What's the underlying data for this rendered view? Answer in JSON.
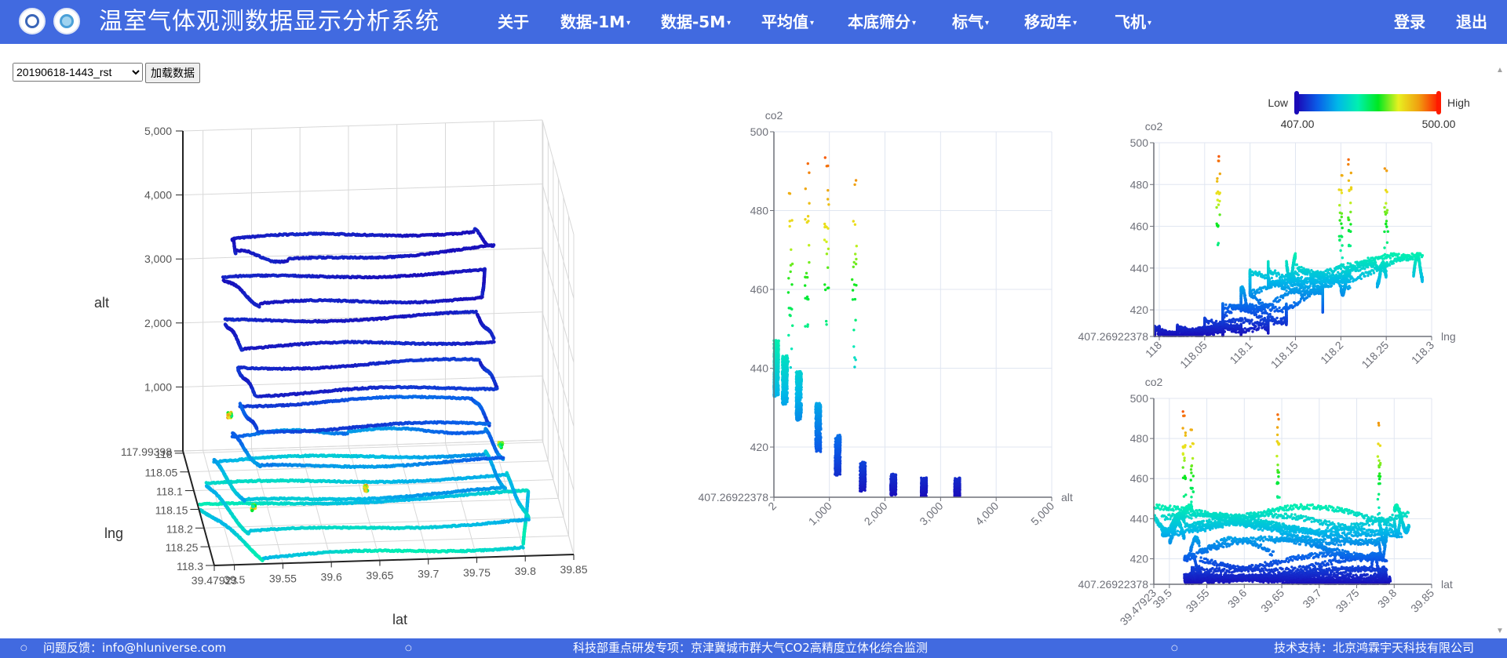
{
  "header": {
    "title": "温室气体观测数据显示分析系统",
    "nav": [
      {
        "label": "关于",
        "dropdown": false
      },
      {
        "label": "数据-1M",
        "dropdown": true
      },
      {
        "label": "数据-5M",
        "dropdown": true
      },
      {
        "label": "平均值",
        "dropdown": true
      },
      {
        "label": "本底筛分",
        "dropdown": true
      },
      {
        "label": "标气",
        "dropdown": true
      },
      {
        "label": "移动车",
        "dropdown": true
      },
      {
        "label": "飞机",
        "dropdown": true
      }
    ],
    "login": "登录",
    "logout": "退出"
  },
  "controls": {
    "file_select_value": "20190618-1443_rst",
    "load_button": "加载数据"
  },
  "footer": {
    "feedback": "问题反馈：info@hluniverse.com",
    "project": "科技部重点研发专项：京津冀城市群大气CO2高精度立体化综合监测",
    "support": "技术支持：北京鸿霖宇天科技有限公司"
  },
  "colors": {
    "header_bg": "#416ae0",
    "colormap": [
      "#1a0ab8",
      "#0a5ee8",
      "#00b8e8",
      "#00f0b0",
      "#00e820",
      "#e8f020",
      "#f0a010",
      "#ff1a00"
    ]
  },
  "visual_map": {
    "low_label": "Low",
    "high_label": "High",
    "min": "407.00",
    "max": "500.00",
    "min_value": 407,
    "max_value": 500
  },
  "flight": {
    "loops": [
      {
        "alt": 3300,
        "co2": [
          408,
          411
        ],
        "path": [
          [
            39.53,
            117.995
          ],
          [
            39.78,
            117.995
          ],
          [
            39.795,
            118.04
          ],
          [
            39.58,
            118.06
          ],
          [
            39.53,
            118.03
          ],
          [
            39.53,
            117.995
          ]
        ]
      },
      {
        "alt": 2700,
        "co2": [
          408,
          411
        ],
        "path": [
          [
            39.52,
            118.0
          ],
          [
            39.79,
            118.0
          ],
          [
            39.78,
            118.07
          ],
          [
            39.55,
            118.07
          ],
          [
            39.52,
            118.0
          ]
        ]
      },
      {
        "alt": 2150,
        "co2": [
          409,
          412
        ],
        "path": [
          [
            39.52,
            118.02
          ],
          [
            39.78,
            118.02
          ],
          [
            39.79,
            118.09
          ],
          [
            39.53,
            118.09
          ],
          [
            39.52,
            118.02
          ]
        ]
      },
      {
        "alt": 1600,
        "co2": [
          410,
          415
        ],
        "path": [
          [
            39.53,
            118.05
          ],
          [
            39.78,
            118.05
          ],
          [
            39.79,
            118.12
          ],
          [
            39.54,
            118.12
          ],
          [
            39.53,
            118.05
          ]
        ]
      },
      {
        "alt": 1150,
        "co2": [
          414,
          422
        ],
        "path": [
          [
            39.53,
            118.07
          ],
          [
            39.77,
            118.07
          ],
          [
            39.78,
            118.14
          ],
          [
            39.54,
            118.14
          ],
          [
            39.53,
            118.07
          ]
        ]
      },
      {
        "alt": 800,
        "co2": [
          420,
          430
        ],
        "path": [
          [
            39.52,
            118.09
          ],
          [
            39.64,
            118.09
          ],
          [
            39.78,
            118.1
          ],
          [
            39.79,
            118.18
          ],
          [
            39.54,
            118.18
          ],
          [
            39.52,
            118.09
          ]
        ]
      },
      {
        "alt": 450,
        "co2": [
          428,
          438
        ],
        "path": [
          [
            39.5,
            118.1
          ],
          [
            39.78,
            118.1
          ],
          [
            39.79,
            118.2
          ],
          [
            39.52,
            118.21
          ],
          [
            39.5,
            118.1
          ]
        ]
      },
      {
        "alt": 200,
        "co2": [
          432,
          442
        ],
        "path": [
          [
            39.49,
            118.12
          ],
          [
            39.8,
            118.12
          ],
          [
            39.81,
            118.24
          ],
          [
            39.52,
            118.25
          ],
          [
            39.49,
            118.12
          ]
        ]
      },
      {
        "alt": 40,
        "co2": [
          434,
          446
        ],
        "path": [
          [
            39.48,
            118.15
          ],
          [
            39.82,
            118.14
          ],
          [
            39.8,
            118.28
          ],
          [
            39.53,
            118.29
          ],
          [
            39.48,
            118.15
          ]
        ]
      }
    ],
    "spikes": [
      {
        "lat": 39.52,
        "lng": 118.065,
        "alt": 950,
        "co2": [
          450,
          499
        ]
      },
      {
        "lat": 39.645,
        "lng": 118.21,
        "alt": 600,
        "co2": [
          445,
          492
        ]
      },
      {
        "lat": 39.78,
        "lng": 118.25,
        "alt": 1450,
        "co2": [
          440,
          488
        ]
      },
      {
        "lat": 39.53,
        "lng": 118.2,
        "alt": 300,
        "co2": [
          440,
          486
        ]
      }
    ]
  },
  "chart_data": [
    {
      "type": "scatter3d",
      "xlabel": "lat",
      "ylabel": "lng",
      "zlabel": "alt",
      "xlim": [
        39.47923,
        39.85
      ],
      "ylim": [
        117.99398,
        118.3
      ],
      "zlim": [
        0,
        5000
      ],
      "x_ticks": [
        "39.47923",
        "39.5",
        "39.55",
        "39.6",
        "39.65",
        "39.7",
        "39.75",
        "39.8",
        "39.85"
      ],
      "y_ticks": [
        "117.99398",
        "118",
        "118.05",
        "118.1",
        "118.15",
        "118.2",
        "118.25",
        "118.3"
      ],
      "z_ticks": [
        "1,000",
        "2,000",
        "3,000",
        "4,000",
        "5,000"
      ],
      "color_by": "co2"
    },
    {
      "type": "scatter",
      "xlabel": "alt",
      "ylabel": "co2",
      "xlim": [
        2,
        5000
      ],
      "ylim": [
        407.26922378,
        500
      ],
      "x_ticks": [
        "2",
        "1,000",
        "2,000",
        "3,000",
        "4,000",
        "5,000"
      ],
      "y_ticks": [
        "407.26922378",
        "420",
        "440",
        "460",
        "480",
        "500"
      ],
      "grid": true
    },
    {
      "type": "scatter",
      "xlabel": "lng",
      "ylabel": "co2",
      "xlim": [
        117.99398,
        118.3
      ],
      "ylim": [
        407.26922378,
        500
      ],
      "x_ticks": [
        "118",
        "118.05",
        "118.1",
        "118.15",
        "118.2",
        "118.25",
        "118.3"
      ],
      "y_ticks": [
        "407.26922378",
        "420",
        "440",
        "460",
        "480",
        "500"
      ],
      "grid": true
    },
    {
      "type": "scatter",
      "xlabel": "lat",
      "ylabel": "co2",
      "xlim": [
        39.47923,
        39.85
      ],
      "ylim": [
        407.26922378,
        500
      ],
      "x_ticks": [
        "39.47923",
        "39.5",
        "39.55",
        "39.6",
        "39.65",
        "39.7",
        "39.75",
        "39.8",
        "39.85"
      ],
      "y_ticks": [
        "407.26922378",
        "420",
        "440",
        "460",
        "480",
        "500"
      ],
      "grid": true
    }
  ]
}
